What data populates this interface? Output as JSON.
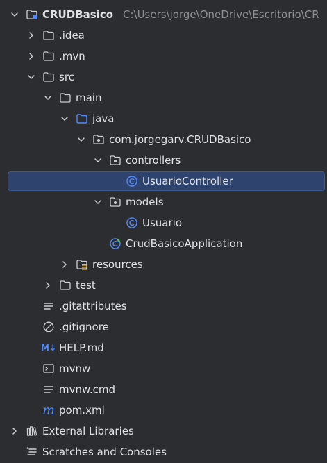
{
  "project_tree": {
    "root": {
      "label": "CRUDBasico",
      "path": "C:\\Users\\jorge\\OneDrive\\Escritorio\\CR"
    },
    "items": [
      {
        "label": "CRUDBasico",
        "icon": "module-folder-icon"
      },
      {
        "label": ".idea",
        "icon": "folder-icon"
      },
      {
        "label": ".mvn",
        "icon": "folder-icon"
      },
      {
        "label": "src",
        "icon": "folder-icon"
      },
      {
        "label": "main",
        "icon": "folder-icon"
      },
      {
        "label": "java",
        "icon": "source-folder-icon"
      },
      {
        "label": "com.jorgegarv.CRUDBasico",
        "icon": "package-icon"
      },
      {
        "label": "controllers",
        "icon": "package-icon"
      },
      {
        "label": "UsuarioController",
        "icon": "class-icon"
      },
      {
        "label": "models",
        "icon": "package-icon"
      },
      {
        "label": "Usuario",
        "icon": "class-icon"
      },
      {
        "label": "CrudBasicoApplication",
        "icon": "spring-boot-class-icon"
      },
      {
        "label": "resources",
        "icon": "resources-folder-icon"
      },
      {
        "label": "test",
        "icon": "folder-icon"
      },
      {
        "label": ".gitattributes",
        "icon": "text-file-icon"
      },
      {
        "label": ".gitignore",
        "icon": "ignore-file-icon"
      },
      {
        "label": "HELP.md",
        "icon": "markdown-icon",
        "icon_text": "M↓"
      },
      {
        "label": "mvnw",
        "icon": "shell-script-icon"
      },
      {
        "label": "mvnw.cmd",
        "icon": "text-file-icon"
      },
      {
        "label": "pom.xml",
        "icon": "maven-icon",
        "icon_text": "m"
      },
      {
        "label": "External Libraries",
        "icon": "libraries-icon"
      },
      {
        "label": "Scratches and Consoles",
        "icon": "scratches-icon"
      }
    ]
  },
  "colors": {
    "background": "#2b2d30",
    "text": "#dfe1e5",
    "path_text": "#8c8f94",
    "selection": "#2e436e",
    "icon_blue": "#548af7",
    "icon_gray": "#ced0d6",
    "spring_green": "#5fb865"
  }
}
